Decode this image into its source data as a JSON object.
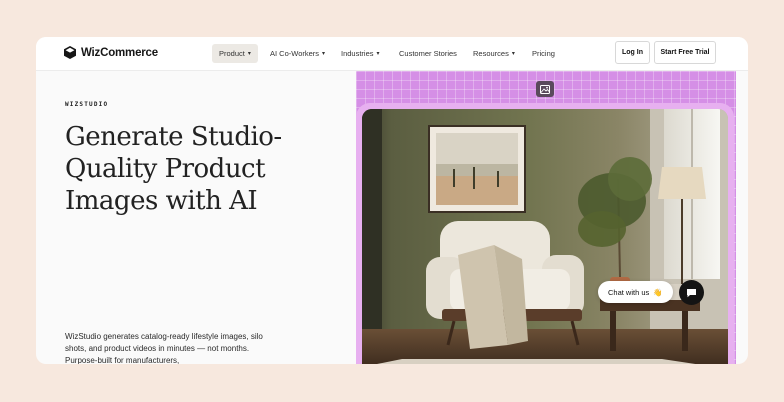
{
  "nav": {
    "brand": "WizCommerce",
    "items": [
      {
        "label": "Product",
        "has_chevron": true
      },
      {
        "label": "AI Co-Workers",
        "has_chevron": true
      },
      {
        "label": "Industries",
        "has_chevron": true
      },
      {
        "label": "Customer Stories",
        "has_chevron": false
      },
      {
        "label": "Resources",
        "has_chevron": true
      },
      {
        "label": "Pricing",
        "has_chevron": false
      }
    ],
    "login": "Log In",
    "trial": "Start Free Trial"
  },
  "hero": {
    "eyebrow": "WIZSTUDIO",
    "headline_lines": [
      "Generate Studio-",
      "Quality Product",
      "Images with AI"
    ],
    "description": "WizStudio generates catalog-ready lifestyle images, silo shots, and product videos in minutes — not months. Purpose-built for manufacturers,"
  },
  "chat": {
    "label": "Chat with us",
    "emoji": "👋"
  },
  "colors": {
    "page_bg": "#f7e8de",
    "hero_purple": "#d58fe6",
    "frame_pink": "#e7b0f0"
  },
  "icons": [
    "logo-cube-icon",
    "chevron-down-icon",
    "image-icon",
    "chat-bubble-icon"
  ]
}
